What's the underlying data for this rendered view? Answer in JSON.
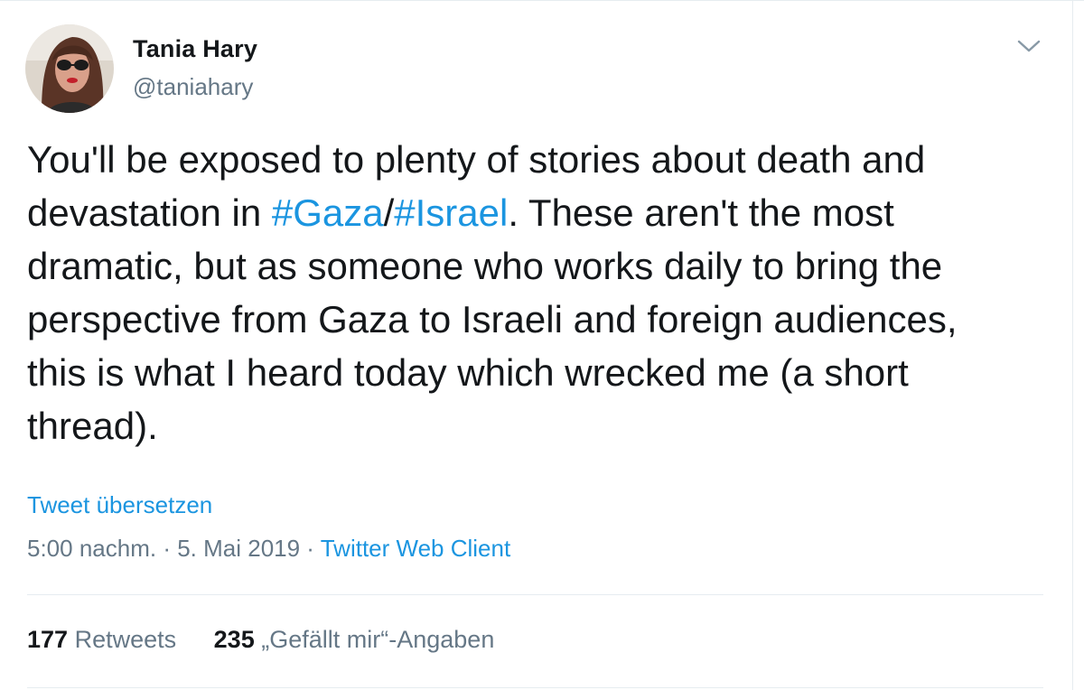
{
  "tweet": {
    "author": {
      "name": "Tania Hary",
      "handle": "@taniahary"
    },
    "text_lines": [
      {
        "pre": "You'll be exposed to plenty of stories about death and"
      },
      {
        "pre": "devastation in ",
        "tag1": "#Gaza",
        "sep": "/",
        "tag2": "#Israel",
        "post": ". These aren't the most"
      },
      {
        "pre": "dramatic, but as someone who works daily to bring the"
      },
      {
        "pre": "perspective from Gaza to Israeli and foreign audiences,"
      },
      {
        "pre": "this is what I heard today which wrecked me (a short"
      },
      {
        "pre": "thread)."
      }
    ],
    "translate_label": "Tweet übersetzen",
    "meta": {
      "time": "5:00 nachm.",
      "separator1": " · ",
      "date": "5. Mai 2019",
      "separator2": " · ",
      "client": "Twitter Web Client"
    },
    "stats": {
      "retweets_count": "177",
      "retweets_label": "Retweets",
      "likes_count": "235",
      "likes_label": "„Gefällt mir“-Angaben"
    }
  },
  "icons": {
    "menu": "chevron-down-icon",
    "avatar": "profile-photo"
  },
  "colors": {
    "text": "#14171a",
    "secondary": "#657786",
    "link": "#1b95e0",
    "divider": "#e6ecf0"
  }
}
